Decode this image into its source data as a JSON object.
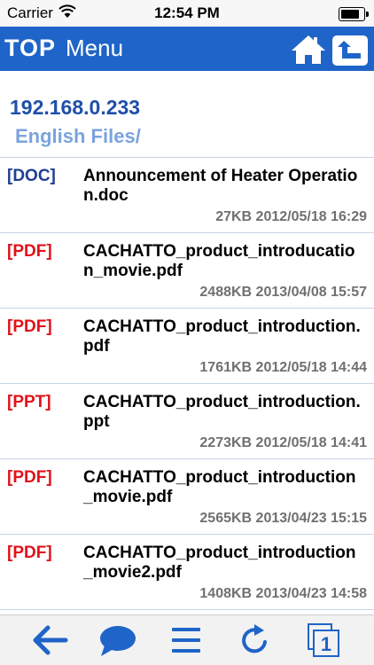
{
  "status_bar": {
    "carrier": "Carrier",
    "time": "12:54 PM",
    "battery_level": 0.9
  },
  "nav_bar": {
    "top_label": "TOP",
    "menu_label": "Menu"
  },
  "location": {
    "host": "192.168.0.233",
    "folder": "English Files/"
  },
  "files": [
    {
      "type": "[DOC]",
      "kind": "doc",
      "name": "Announcement of Heater Operation.doc",
      "meta": "27KB 2012/05/18 16:29"
    },
    {
      "type": "[PDF]",
      "kind": "pdf",
      "name": "CACHATTO_product_introducation_movie.pdf",
      "meta": "2488KB 2013/04/08 15:57"
    },
    {
      "type": "[PDF]",
      "kind": "pdf",
      "name": "CACHATTO_product_introduction.pdf",
      "meta": "1761KB 2012/05/18 14:44"
    },
    {
      "type": "[PPT]",
      "kind": "ppt",
      "name": "CACHATTO_product_introduction.ppt",
      "meta": "2273KB 2012/05/18 14:41"
    },
    {
      "type": "[PDF]",
      "kind": "pdf",
      "name": "CACHATTO_product_introduction_movie.pdf",
      "meta": "2565KB 2013/04/23 15:15"
    },
    {
      "type": "[PDF]",
      "kind": "pdf",
      "name": "CACHATTO_product_introduction_movie2.pdf",
      "meta": "1408KB 2013/04/23 14:58"
    }
  ],
  "toolbar": {
    "icons": [
      "back-arrow-icon",
      "speech-bubble-icon",
      "menu-lines-icon",
      "refresh-icon",
      "window-1-icon"
    ],
    "window_count": "1",
    "accent": "#1f64c8"
  }
}
